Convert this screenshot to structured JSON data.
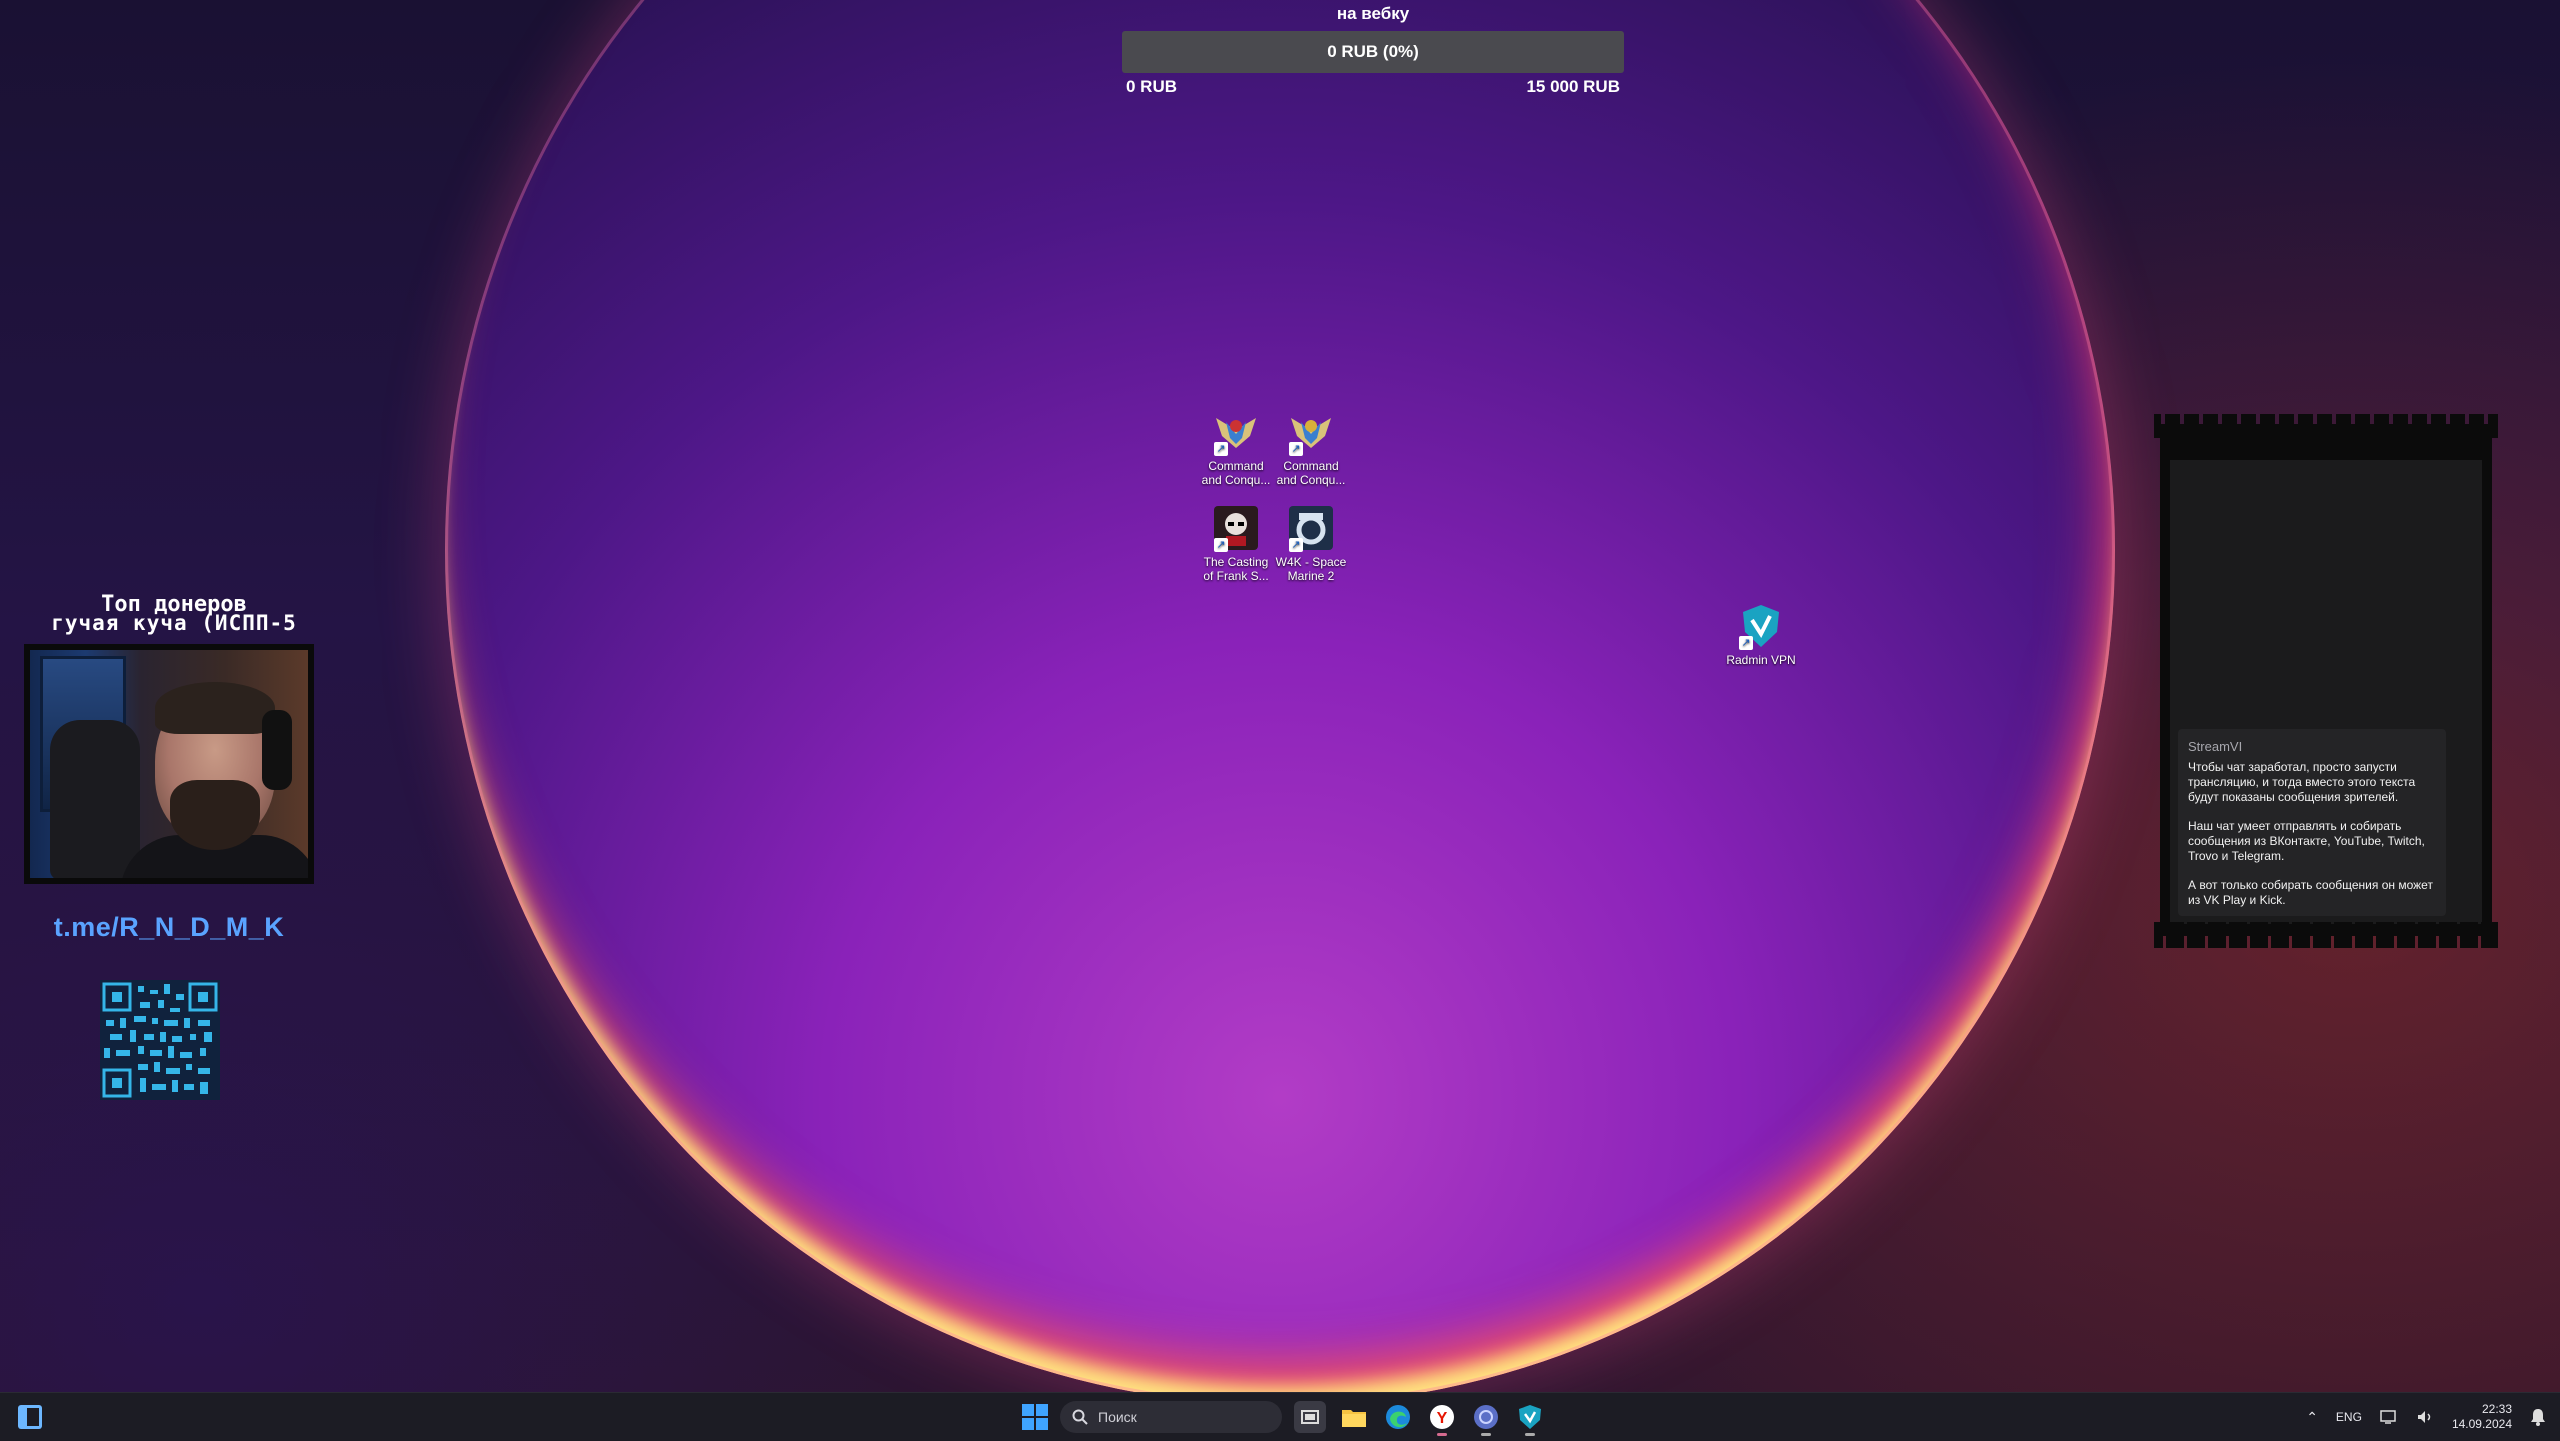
{
  "donation_goal": {
    "title": "на вебку",
    "progress_label": "0 RUB (0%)",
    "progress_fraction": 0,
    "min_label": "0 RUB",
    "max_label": "15 000 RUB"
  },
  "desktop_icons": [
    {
      "label": "Command and Conqu...",
      "icon": "command-and-conquer-icon"
    },
    {
      "label": "Command and Conqu...",
      "icon": "command-and-conquer-icon"
    },
    {
      "label": "The Casting of Frank S...",
      "icon": "the-casting-of-frank-stone-icon"
    },
    {
      "label": "W4K - Space Marine 2",
      "icon": "space-marine-icon"
    },
    {
      "label": "Radmin VPN",
      "icon": "radmin-vpn-icon"
    }
  ],
  "stream_overlay": {
    "top_donors_title": "Топ донеров",
    "top_donors_subtitle": "гучая куча (ИСПП-5",
    "telegram_link": "t.me/R_N_D_M_K"
  },
  "chat_widget": {
    "author": "StreamVI",
    "messages": [
      "Чтобы чат заработал, просто запусти трансляцию, и тогда вместо этого текста будут показаны сообщения зрителей.",
      "Наш чат умеет отправлять и собирать сообщения из ВКонтакте, YouTube, Twitch, Trovo и Telegram.",
      "А вот только собирать сообщения он может из VK Play и Kick."
    ]
  },
  "taskbar": {
    "search_placeholder": "Поиск",
    "language": "ENG",
    "time": "22:33",
    "date": "14.09.2024",
    "apps": [
      "file-explorer-icon",
      "edge-icon",
      "yandex-browser-icon",
      "globe-app-icon",
      "radmin-vpn-icon"
    ]
  },
  "colors": {
    "accent_link": "#5aa3ff",
    "windows_blue": "#3fa4ff"
  }
}
